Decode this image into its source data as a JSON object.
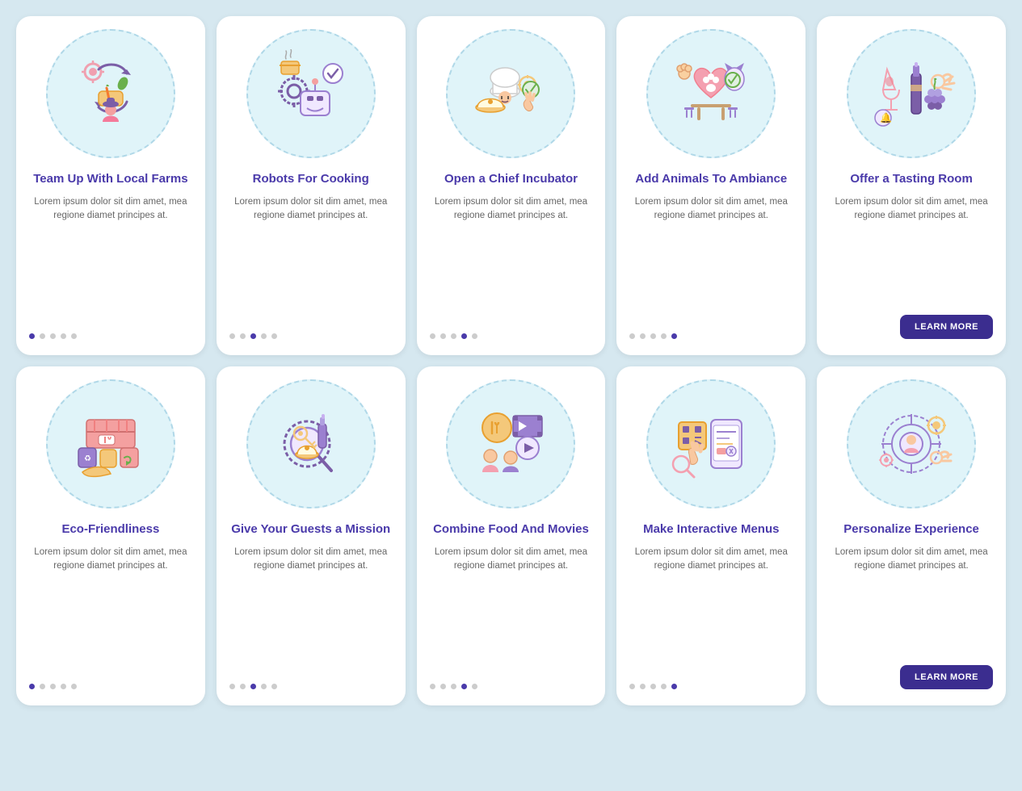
{
  "cards": [
    {
      "id": "card-1",
      "title": "Team Up With Local Farms",
      "body": "Lorem ipsum dolor sit dim amet, mea regione diamet principes at.",
      "dots": [
        1,
        0,
        0,
        0,
        0
      ],
      "hasButton": false,
      "iconColor": "#e8e0ff"
    },
    {
      "id": "card-2",
      "title": "Robots For Cooking",
      "body": "Lorem ipsum dolor sit dim amet, mea regione diamet principes at.",
      "dots": [
        0,
        0,
        1,
        0,
        0
      ],
      "hasButton": false,
      "iconColor": "#e8e0ff"
    },
    {
      "id": "card-3",
      "title": "Open a Chief Incubator",
      "body": "Lorem ipsum dolor sit dim amet, mea regione diamet principes at.",
      "dots": [
        0,
        0,
        0,
        1,
        0
      ],
      "hasButton": false,
      "iconColor": "#e8e0ff"
    },
    {
      "id": "card-4",
      "title": "Add Animals To Ambiance",
      "body": "Lorem ipsum dolor sit dim amet, mea regione diamet principes at.",
      "dots": [
        0,
        0,
        0,
        0,
        1
      ],
      "hasButton": false,
      "iconColor": "#e8e0ff"
    },
    {
      "id": "card-5",
      "title": "Offer a Tasting Room",
      "body": "Lorem ipsum dolor sit dim amet, mea regione diamet principes at.",
      "dots": [
        0,
        0,
        0,
        0,
        0
      ],
      "hasButton": true,
      "buttonLabel": "LEARN MORE",
      "iconColor": "#e8e0ff"
    },
    {
      "id": "card-6",
      "title": "Eco-Friendliness",
      "body": "Lorem ipsum dolor sit dim amet, mea regione diamet principes at.",
      "dots": [
        1,
        0,
        0,
        0,
        0
      ],
      "hasButton": false,
      "iconColor": "#e8e0ff"
    },
    {
      "id": "card-7",
      "title": "Give Your Guests a Mission",
      "body": "Lorem ipsum dolor sit dim amet, mea regione diamet principes at.",
      "dots": [
        0,
        0,
        1,
        0,
        0
      ],
      "hasButton": false,
      "iconColor": "#e8e0ff"
    },
    {
      "id": "card-8",
      "title": "Combine Food And Movies",
      "body": "Lorem ipsum dolor sit dim amet, mea regione diamet principes at.",
      "dots": [
        0,
        0,
        0,
        1,
        0
      ],
      "hasButton": false,
      "iconColor": "#e8e0ff"
    },
    {
      "id": "card-9",
      "title": "Make Interactive Menus",
      "body": "Lorem ipsum dolor sit dim amet, mea regione diamet principes at.",
      "dots": [
        0,
        0,
        0,
        0,
        1
      ],
      "hasButton": false,
      "iconColor": "#e8e0ff"
    },
    {
      "id": "card-10",
      "title": "Personalize Experience",
      "body": "Lorem ipsum dolor sit dim amet, mea regione diamet principes at.",
      "dots": [
        0,
        0,
        0,
        0,
        0
      ],
      "hasButton": true,
      "buttonLabel": "LEARN MORE",
      "iconColor": "#e8e0ff"
    }
  ],
  "buttons": {
    "learn_more": "LEARN MORE"
  }
}
